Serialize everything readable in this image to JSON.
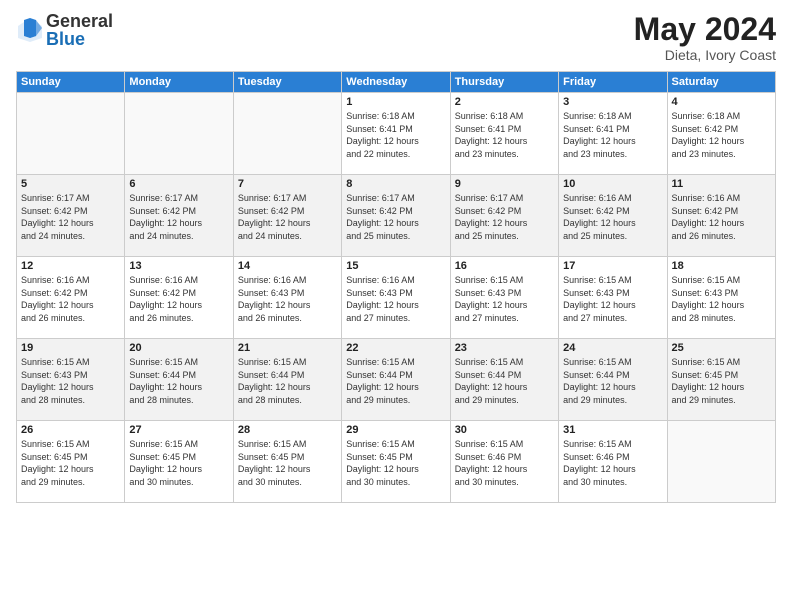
{
  "logo": {
    "general": "General",
    "blue": "Blue"
  },
  "title": {
    "month_year": "May 2024",
    "location": "Dieta, Ivory Coast"
  },
  "days_of_week": [
    "Sunday",
    "Monday",
    "Tuesday",
    "Wednesday",
    "Thursday",
    "Friday",
    "Saturday"
  ],
  "weeks": [
    [
      {
        "day": "",
        "info": ""
      },
      {
        "day": "",
        "info": ""
      },
      {
        "day": "",
        "info": ""
      },
      {
        "day": "1",
        "info": "Sunrise: 6:18 AM\nSunset: 6:41 PM\nDaylight: 12 hours\nand 22 minutes."
      },
      {
        "day": "2",
        "info": "Sunrise: 6:18 AM\nSunset: 6:41 PM\nDaylight: 12 hours\nand 23 minutes."
      },
      {
        "day": "3",
        "info": "Sunrise: 6:18 AM\nSunset: 6:41 PM\nDaylight: 12 hours\nand 23 minutes."
      },
      {
        "day": "4",
        "info": "Sunrise: 6:18 AM\nSunset: 6:42 PM\nDaylight: 12 hours\nand 23 minutes."
      }
    ],
    [
      {
        "day": "5",
        "info": "Sunrise: 6:17 AM\nSunset: 6:42 PM\nDaylight: 12 hours\nand 24 minutes."
      },
      {
        "day": "6",
        "info": "Sunrise: 6:17 AM\nSunset: 6:42 PM\nDaylight: 12 hours\nand 24 minutes."
      },
      {
        "day": "7",
        "info": "Sunrise: 6:17 AM\nSunset: 6:42 PM\nDaylight: 12 hours\nand 24 minutes."
      },
      {
        "day": "8",
        "info": "Sunrise: 6:17 AM\nSunset: 6:42 PM\nDaylight: 12 hours\nand 25 minutes."
      },
      {
        "day": "9",
        "info": "Sunrise: 6:17 AM\nSunset: 6:42 PM\nDaylight: 12 hours\nand 25 minutes."
      },
      {
        "day": "10",
        "info": "Sunrise: 6:16 AM\nSunset: 6:42 PM\nDaylight: 12 hours\nand 25 minutes."
      },
      {
        "day": "11",
        "info": "Sunrise: 6:16 AM\nSunset: 6:42 PM\nDaylight: 12 hours\nand 26 minutes."
      }
    ],
    [
      {
        "day": "12",
        "info": "Sunrise: 6:16 AM\nSunset: 6:42 PM\nDaylight: 12 hours\nand 26 minutes."
      },
      {
        "day": "13",
        "info": "Sunrise: 6:16 AM\nSunset: 6:42 PM\nDaylight: 12 hours\nand 26 minutes."
      },
      {
        "day": "14",
        "info": "Sunrise: 6:16 AM\nSunset: 6:43 PM\nDaylight: 12 hours\nand 26 minutes."
      },
      {
        "day": "15",
        "info": "Sunrise: 6:16 AM\nSunset: 6:43 PM\nDaylight: 12 hours\nand 27 minutes."
      },
      {
        "day": "16",
        "info": "Sunrise: 6:15 AM\nSunset: 6:43 PM\nDaylight: 12 hours\nand 27 minutes."
      },
      {
        "day": "17",
        "info": "Sunrise: 6:15 AM\nSunset: 6:43 PM\nDaylight: 12 hours\nand 27 minutes."
      },
      {
        "day": "18",
        "info": "Sunrise: 6:15 AM\nSunset: 6:43 PM\nDaylight: 12 hours\nand 28 minutes."
      }
    ],
    [
      {
        "day": "19",
        "info": "Sunrise: 6:15 AM\nSunset: 6:43 PM\nDaylight: 12 hours\nand 28 minutes."
      },
      {
        "day": "20",
        "info": "Sunrise: 6:15 AM\nSunset: 6:44 PM\nDaylight: 12 hours\nand 28 minutes."
      },
      {
        "day": "21",
        "info": "Sunrise: 6:15 AM\nSunset: 6:44 PM\nDaylight: 12 hours\nand 28 minutes."
      },
      {
        "day": "22",
        "info": "Sunrise: 6:15 AM\nSunset: 6:44 PM\nDaylight: 12 hours\nand 29 minutes."
      },
      {
        "day": "23",
        "info": "Sunrise: 6:15 AM\nSunset: 6:44 PM\nDaylight: 12 hours\nand 29 minutes."
      },
      {
        "day": "24",
        "info": "Sunrise: 6:15 AM\nSunset: 6:44 PM\nDaylight: 12 hours\nand 29 minutes."
      },
      {
        "day": "25",
        "info": "Sunrise: 6:15 AM\nSunset: 6:45 PM\nDaylight: 12 hours\nand 29 minutes."
      }
    ],
    [
      {
        "day": "26",
        "info": "Sunrise: 6:15 AM\nSunset: 6:45 PM\nDaylight: 12 hours\nand 29 minutes."
      },
      {
        "day": "27",
        "info": "Sunrise: 6:15 AM\nSunset: 6:45 PM\nDaylight: 12 hours\nand 30 minutes."
      },
      {
        "day": "28",
        "info": "Sunrise: 6:15 AM\nSunset: 6:45 PM\nDaylight: 12 hours\nand 30 minutes."
      },
      {
        "day": "29",
        "info": "Sunrise: 6:15 AM\nSunset: 6:45 PM\nDaylight: 12 hours\nand 30 minutes."
      },
      {
        "day": "30",
        "info": "Sunrise: 6:15 AM\nSunset: 6:46 PM\nDaylight: 12 hours\nand 30 minutes."
      },
      {
        "day": "31",
        "info": "Sunrise: 6:15 AM\nSunset: 6:46 PM\nDaylight: 12 hours\nand 30 minutes."
      },
      {
        "day": "",
        "info": ""
      }
    ]
  ]
}
